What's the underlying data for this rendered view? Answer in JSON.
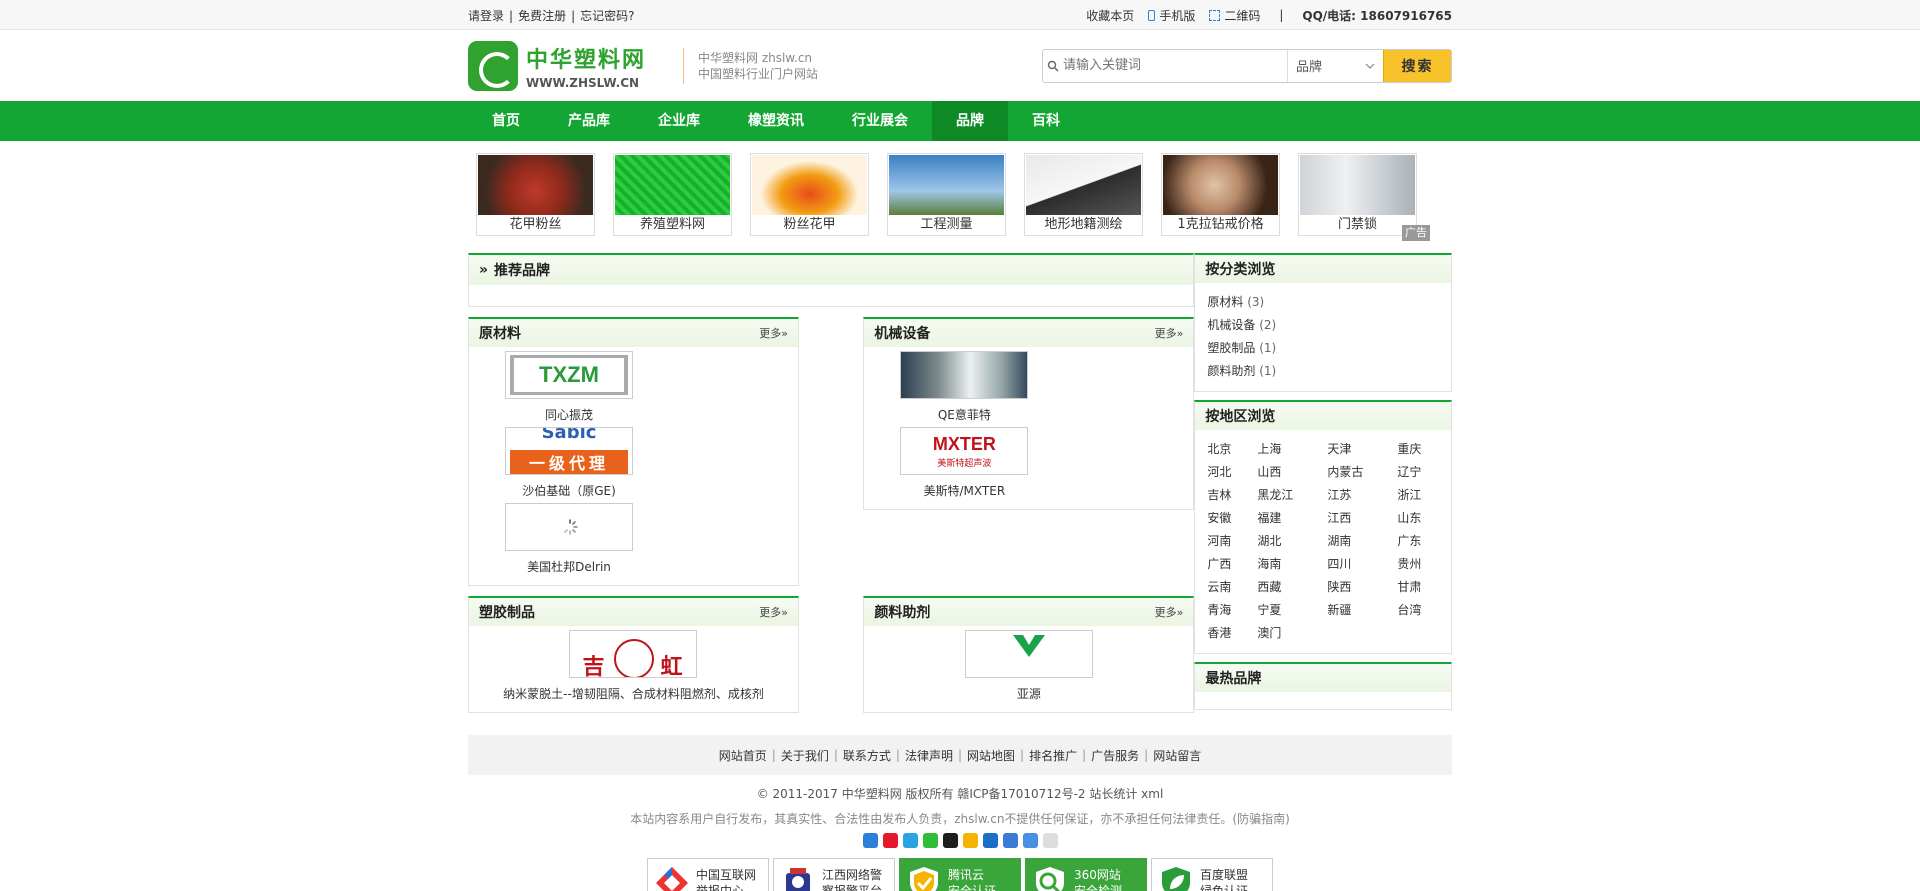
{
  "topbar": {
    "login": "请登录",
    "register": "免费注册",
    "forgot": "忘记密码?",
    "bookmark": "收藏本页",
    "mobile": "手机版",
    "qrcode": "二维码",
    "qq": "QQ/电话: 18607916765"
  },
  "header": {
    "logo_cn": "中华塑料网",
    "logo_en": "WWW.ZHSLW.CN",
    "slogan1": "中华塑料网 zhslw.cn",
    "slogan2": "中国塑料行业门户网站",
    "search_placeholder": "请输入关键词",
    "search_select": "品牌",
    "search_button": "搜索"
  },
  "nav": [
    "首页",
    "产品库",
    "企业库",
    "橡塑资讯",
    "行业展会",
    "品牌",
    "百科"
  ],
  "ads": {
    "items": [
      "花甲粉丝",
      "养殖塑料网",
      "粉丝花甲",
      "工程测量",
      "地形地籍测绘",
      "1克拉钻戒价格",
      "门禁锁"
    ],
    "tag": "广告"
  },
  "recommend": {
    "title": "推荐品牌"
  },
  "categories": [
    {
      "title": "原材料",
      "more": "更多»",
      "brands": [
        "同心振茂",
        "沙伯基础（原GE)",
        "美国杜邦Delrin"
      ]
    },
    {
      "title": "机械设备",
      "more": "更多»",
      "brands": [
        "QE意菲特",
        "美斯特/MXTER"
      ]
    },
    {
      "title": "塑胶制品",
      "more": "更多»",
      "brands": [
        "纳米蒙脱土--增韧阻隔、合成材料阻燃剂、成核剂"
      ]
    },
    {
      "title": "颜料助剂",
      "more": "更多»",
      "brands": [
        "亚源"
      ]
    }
  ],
  "logos": {
    "txzm": "TXZM",
    "sabic": "Sabic",
    "sabic_sub": "一级代理",
    "mxter": "MXTER",
    "mxter_sub": "美斯特超声波"
  },
  "sidebar": {
    "by_category": {
      "title": "按分类浏览",
      "items": [
        {
          "name": "原材料",
          "count": "(3)"
        },
        {
          "name": "机械设备",
          "count": "(2)"
        },
        {
          "name": "塑胶制品",
          "count": "(1)"
        },
        {
          "name": "颜料助剂",
          "count": "(1)"
        }
      ]
    },
    "by_region": {
      "title": "按地区浏览",
      "items": [
        "北京",
        "上海",
        "天津",
        "重庆",
        "河北",
        "山西",
        "内蒙古",
        "辽宁",
        "吉林",
        "黑龙江",
        "江苏",
        "浙江",
        "安徽",
        "福建",
        "江西",
        "山东",
        "河南",
        "湖北",
        "湖南",
        "广东",
        "广西",
        "海南",
        "四川",
        "贵州",
        "云南",
        "西藏",
        "陕西",
        "甘肃",
        "青海",
        "宁夏",
        "新疆",
        "台湾",
        "香港",
        "澳门"
      ]
    },
    "hot": {
      "title": "最热品牌"
    }
  },
  "footer": {
    "links": [
      "网站首页",
      "关于我们",
      "联系方式",
      "法律声明",
      "网站地图",
      "排名推广",
      "广告服务",
      "网站留言"
    ],
    "copyright": "© 2011-2017  中华塑料网 版权所有   赣ICP备17010712号-2   站长统计 xml",
    "disclaimer": "本站内容系用户自行发布，其真实性、合法性由发布人负责，zhslw.cn不提供任何保证，亦不承担任何法律责任。(防骗指南)",
    "badges": [
      {
        "l1": "中国互联网",
        "l2": "举报中心"
      },
      {
        "l1": "江西网络警",
        "l2": "察报警平台"
      },
      {
        "l1": "腾讯云",
        "l2": "安全认证"
      },
      {
        "l1": "360网站",
        "l2": "安全检测"
      },
      {
        "l1": "百度联盟",
        "l2": "绿色认证"
      }
    ]
  }
}
